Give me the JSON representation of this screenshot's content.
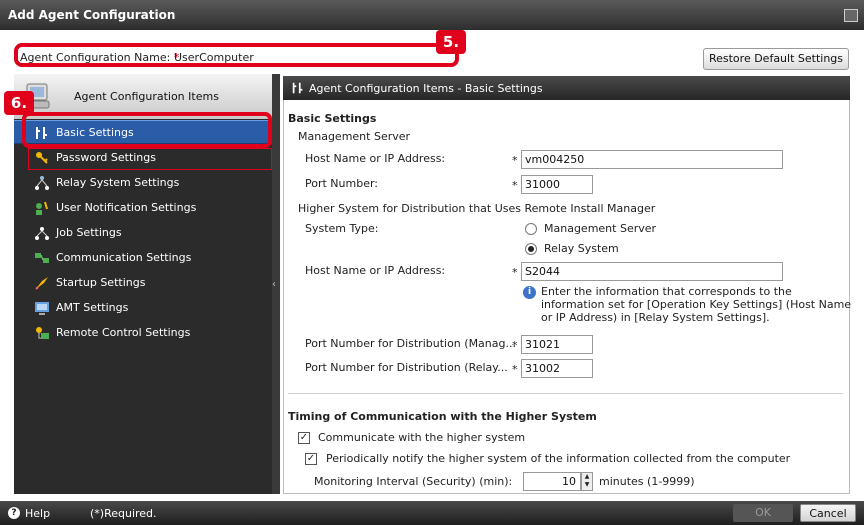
{
  "window": {
    "title": "Add Agent Configuration"
  },
  "name_row": {
    "label": "Agent Configuration Name:",
    "required_mark": "*",
    "value": "UserComputer",
    "badge": "5.",
    "restore_button": "Restore Default Settings"
  },
  "sidebar": {
    "header": "Agent Configuration Items",
    "badge": "6.",
    "items": [
      {
        "label": "Basic Settings",
        "icon": "basic-settings-icon",
        "active": true
      },
      {
        "label": "Password Settings",
        "icon": "key-icon"
      },
      {
        "label": "Relay System Settings",
        "icon": "relay-icon"
      },
      {
        "label": "User Notification Settings",
        "icon": "user-notify-icon"
      },
      {
        "label": "Job Settings",
        "icon": "job-icon"
      },
      {
        "label": "Communication Settings",
        "icon": "communication-icon"
      },
      {
        "label": "Startup Settings",
        "icon": "startup-icon"
      },
      {
        "label": "AMT Settings",
        "icon": "amt-icon"
      },
      {
        "label": "Remote Control Settings",
        "icon": "remote-control-icon"
      }
    ]
  },
  "main": {
    "header": "Agent Configuration Items - Basic Settings",
    "basic": {
      "title": "Basic Settings",
      "management_server": "Management Server",
      "host_label": "Host Name or IP Address:",
      "host_value": "vm004250",
      "port_label": "Port Number:",
      "port_value": "31000",
      "higher_system": "Higher System for Distribution that Uses Remote Install Manager",
      "system_type_label": "System Type:",
      "radio_management": "Management Server",
      "radio_relay": "Relay System",
      "selected_system_type": "Relay System",
      "host2_label": "Host Name or IP Address:",
      "host2_value": "S2044",
      "info_line1": "Enter the information that corresponds to the",
      "info_line2": "information set for [Operation Key Settings] (Host Name",
      "info_line3": "or IP Address) in [Relay System Settings].",
      "port_mgr_label": "Port Number for Distribution (Manag...",
      "port_mgr_value": "31021",
      "port_relay_label": "Port Number for Distribution (Relay...",
      "port_relay_value": "31002"
    },
    "timing": {
      "title": "Timing of Communication with the Higher System",
      "communicate_label": "Communicate with the higher system",
      "communicate_checked": true,
      "notify_label": "Periodically notify the higher system of the information collected from the computer",
      "notify_checked": true,
      "interval_label": "Monitoring Interval (Security) (min):",
      "interval_value": "10",
      "interval_unit": "minutes (1-9999)"
    }
  },
  "footer": {
    "help": "Help",
    "required_note": "(*)Required.",
    "ok": "OK",
    "cancel": "Cancel"
  },
  "colors": {
    "highlight": "#e0001b",
    "active_item": "#2a5ca8",
    "sidebar": "#2b2b2b"
  }
}
